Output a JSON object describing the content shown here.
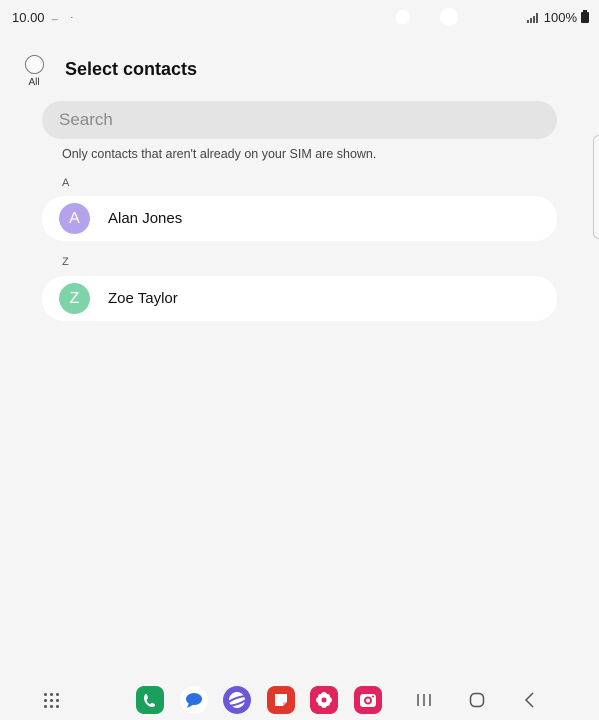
{
  "status_bar": {
    "time": "10.00",
    "notification_dots": "_ .",
    "battery_percent": "100%"
  },
  "header": {
    "select_all_label": "All",
    "title": "Select contacts"
  },
  "search": {
    "placeholder": "Search"
  },
  "info_text": "Only contacts that aren't already on your SIM are shown.",
  "sections": [
    {
      "letter": "A",
      "contacts": [
        {
          "initial": "A",
          "name": "Alan Jones",
          "avatar_color": "#b3a3ec"
        }
      ]
    },
    {
      "letter": "Z",
      "contacts": [
        {
          "initial": "Z",
          "name": "Zoe Taylor",
          "avatar_color": "#7fd3a9"
        }
      ]
    }
  ],
  "taskbar": {
    "apps": [
      {
        "name": "phone-app-icon",
        "color": "#1aa05a"
      },
      {
        "name": "messages-app-icon",
        "color": "#2d6fe0"
      },
      {
        "name": "internet-app-icon",
        "color": "#6a57d9"
      },
      {
        "name": "notes-app-icon",
        "color": "#e0392b"
      },
      {
        "name": "gallery-app-icon",
        "color": "#e0245e"
      },
      {
        "name": "camera-app-icon",
        "color": "#e0245e"
      }
    ],
    "nav": [
      "recents-button",
      "home-button",
      "back-button"
    ]
  }
}
